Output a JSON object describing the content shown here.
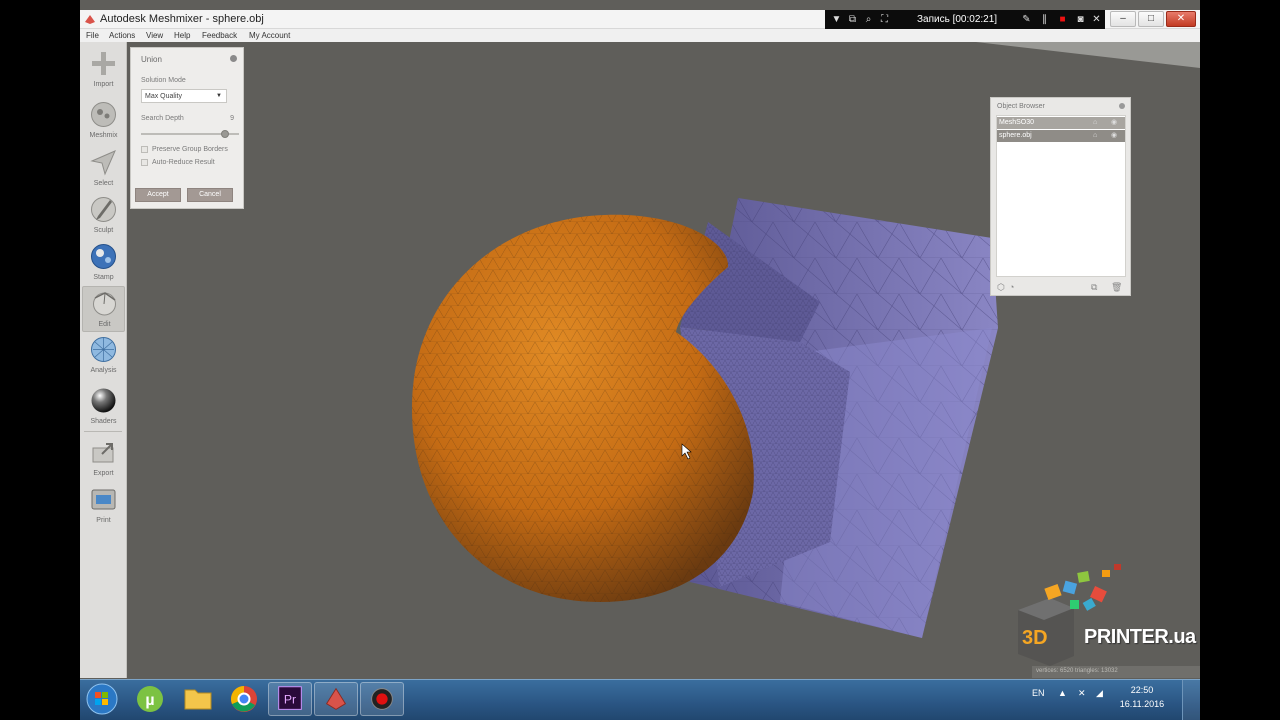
{
  "window": {
    "title": "Autodesk Meshmixer - sphere.obj",
    "recorder_label": "Запись [00:02:21]",
    "buttons": {
      "minimize": "–",
      "maximize": "□",
      "close": "✕"
    }
  },
  "menu": [
    "File",
    "Actions",
    "View",
    "Help",
    "Feedback",
    "My Account"
  ],
  "toolbar": {
    "tools": [
      {
        "label": "Import",
        "icon": "plus-icon"
      },
      {
        "label": "Meshmix",
        "icon": "meshmix-icon"
      },
      {
        "label": "Select",
        "icon": "select-arrow-icon"
      },
      {
        "label": "Sculpt",
        "icon": "sculpt-brush-icon"
      },
      {
        "label": "Stamp",
        "icon": "stamp-icon"
      },
      {
        "label": "Edit",
        "icon": "edit-icon",
        "active": true
      },
      {
        "label": "Analysis",
        "icon": "analysis-icon"
      },
      {
        "label": "Shaders",
        "icon": "shaders-icon"
      },
      {
        "label": "Export",
        "icon": "export-icon"
      },
      {
        "label": "Print",
        "icon": "printer-icon"
      }
    ]
  },
  "union_panel": {
    "title": "Union",
    "solution_mode_label": "Solution Mode",
    "solution_mode_value": "Max Quality",
    "search_depth_label": "Search Depth",
    "search_depth_value": "9",
    "search_depth_level": 0.86,
    "preserve_group_borders": "Preserve Group Borders",
    "auto_reduce_result": "Auto-Reduce Result",
    "accept": "Accept",
    "cancel": "Cancel"
  },
  "object_browser": {
    "title": "Object Browser",
    "objects": [
      "MeshSO30",
      "sphere.obj"
    ]
  },
  "logo": {
    "text": "PRINTER.ua",
    "prefix": "3D"
  },
  "status_bar": "vertices: 6520 triangles: 13032",
  "taskbar": {
    "language": "EN",
    "time": "22:50",
    "date": "16.11.2016"
  },
  "colors": {
    "sphere": "#c8731a",
    "cube": "#7a76b0",
    "viewport": "#5f5e5a",
    "panel_button": "#a39994"
  }
}
